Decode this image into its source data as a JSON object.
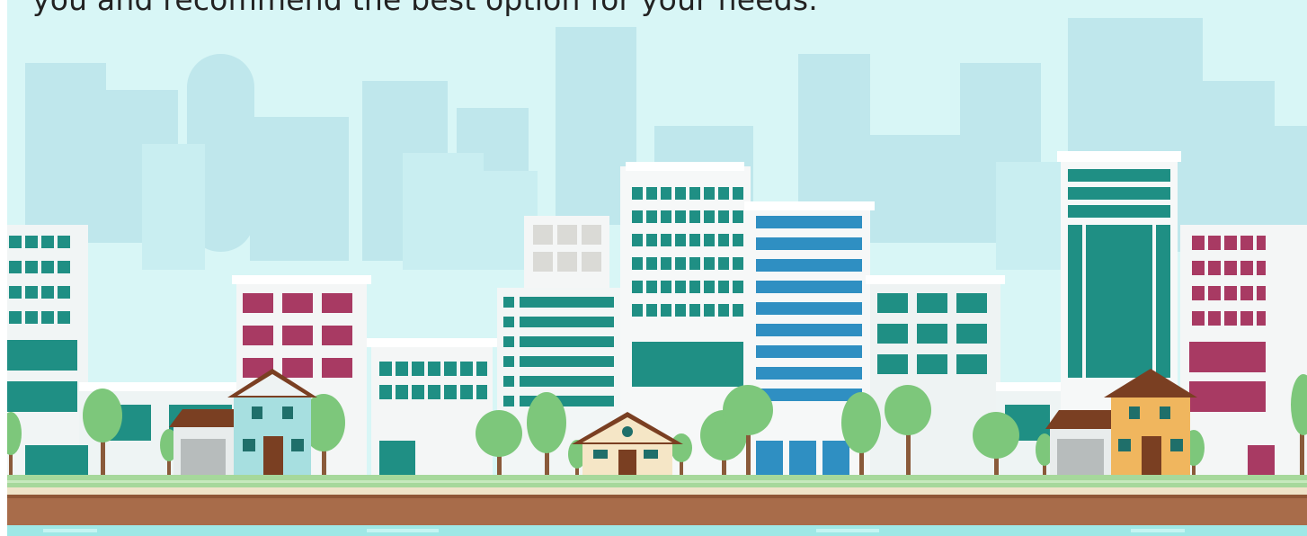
{
  "caption": {
    "text": "you and recommend the best option for your needs."
  },
  "illustration": {
    "subject": "flat-style city skyline with houses and trees",
    "colors": {
      "sky": "#d8f6f6",
      "back_buildings": "#b9e4ea",
      "teal": "#1f8f84",
      "blue": "#2f8fc2",
      "magenta": "#a83a63",
      "tree": "#7dc77b",
      "fence": "#a6d89b",
      "ground": "#a86c4a",
      "water": "#9fe8e6"
    }
  }
}
